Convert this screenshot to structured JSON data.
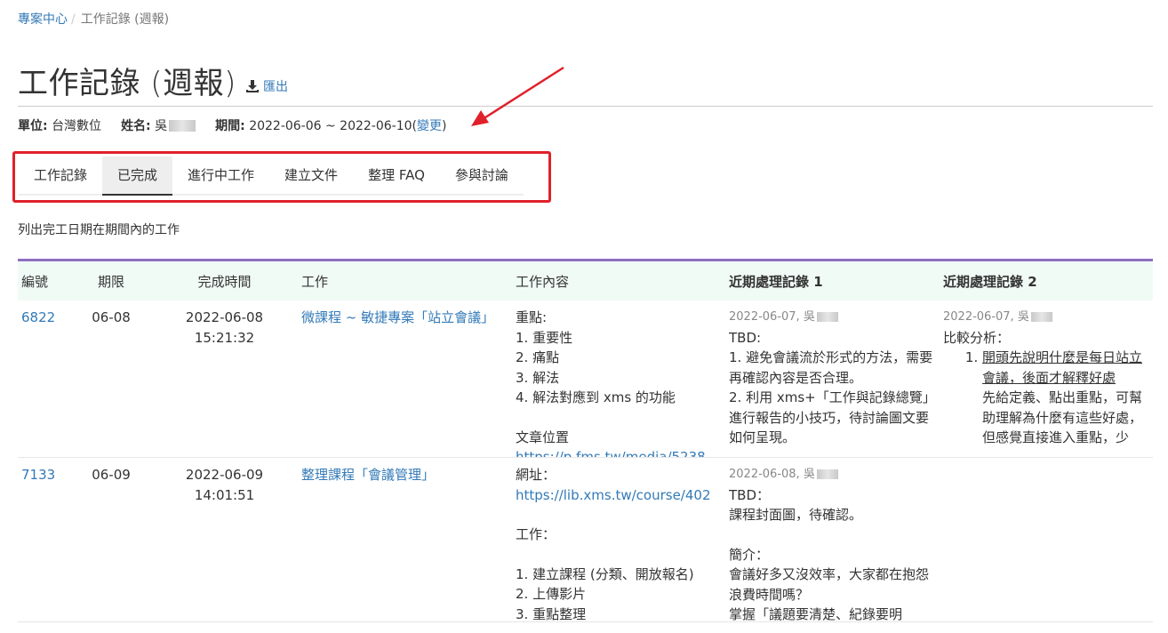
{
  "breadcrumb": {
    "home": "專案中心",
    "separator": "/",
    "current": "工作記錄 (週報)"
  },
  "page": {
    "title": "工作記錄 (週報)",
    "export_label": "匯出"
  },
  "meta": {
    "unit_label": "單位:",
    "unit_value": "台灣數位",
    "name_label": "姓名:",
    "name_value": "吳",
    "period_label": "期間:",
    "period_value": "2022-06-06 ~ 2022-06-10",
    "change_open": "(",
    "change_label": "變更",
    "change_close": ")"
  },
  "tabs": [
    {
      "label": "工作記錄"
    },
    {
      "label": "已完成",
      "active": true
    },
    {
      "label": "進行中工作"
    },
    {
      "label": "建立文件"
    },
    {
      "label": "整理 FAQ"
    },
    {
      "label": "參與討論"
    }
  ],
  "description": "列出完工日期在期間內的工作",
  "table": {
    "headers": [
      "編號",
      "期限",
      "完成時間",
      "工作",
      "工作內容",
      "近期處理記錄 1",
      "近期處理記錄 2"
    ],
    "rows": [
      {
        "id": "6822",
        "due": "06-08",
        "done": "2022-06-08 15:21:32",
        "work": "微課程 ~ 敏捷專案「站立會議」",
        "content": [
          "重點:",
          "1. 重要性",
          "2. 痛點",
          "3. 解法",
          "4. 解法對應到 xms 的功能",
          "",
          "文章位置",
          "https://p.fms.tw/media/5238"
        ],
        "log1_meta": "2022-06-07, 吳",
        "log1": [
          "TBD:",
          "1. 避免會議流於形式的方法，需要再確認內容是否合理。",
          "2. 利用 xms+「工作與記錄總覽」進行報告的小技巧，待討論圖文要如何呈現。"
        ],
        "log2_meta": "2022-06-07, 吳",
        "log2_head": "比較分析：",
        "log2_item_u": "開頭先說明什麼是每日站立會議，後面才解釋好處",
        "log2_item_rest": "先給定義、點出重點，可幫助理解為什麼有這些好處，",
        "log2_item_more": "但感覺直接進入重點，少"
      },
      {
        "id": "7133",
        "due": "06-09",
        "done": "2022-06-09 14:01:51",
        "work": "整理課程「會議管理」",
        "content_label": "網址：",
        "content_link": "https://lib.xms.tw/course/402",
        "content": [
          "",
          "工作：",
          "",
          "1. 建立課程 (分類、開放報名)",
          "2. 上傳影片",
          "3. 重點整理"
        ],
        "log1_meta": "2022-06-08, 吳",
        "log1": [
          "TBD：",
          "課程封面圖，待確認。",
          "",
          "簡介：",
          "會議好多又沒效率，大家都在抱怨浪費時間嗎？",
          "掌握「議題要清楚、紀錄要明"
        ]
      }
    ]
  }
}
